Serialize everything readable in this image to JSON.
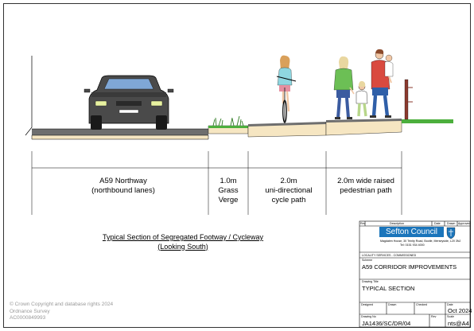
{
  "labels": {
    "lanes": [
      "A59 Northway",
      "(northbound lanes)"
    ],
    "verge": [
      "1.0m",
      "Grass",
      "Verge"
    ],
    "cycle": [
      "2.0m",
      "uni-directional",
      "cycle path"
    ],
    "footpath": [
      "2.0m wide raised",
      "pedestrian path"
    ]
  },
  "caption": [
    "Typical Section of Segregated Footway / Cycleway",
    "(Looking South)"
  ],
  "copyright": [
    "© Crown Copyright and database rights 2024",
    "Ordnance Survey",
    "AC0000849993"
  ],
  "title_block": {
    "rev_headers": [
      "Rev",
      "Description",
      "Date",
      "Drawn",
      "Approved"
    ],
    "council_name": "Sefton Council",
    "council_address": "Magdalen House, 30 Trinity Road, Bootle, Merseyside, L20 3NJ",
    "council_phone": "Tel: 0151 934 4000",
    "department": "LOCALITY SERVICES - COMMISSIONED",
    "scheme_label": "Scheme",
    "scheme": "A59 CORRIDOR IMPROVEMENTS",
    "drawing_title_label": "Drawing Title",
    "drawing_title": "TYPICAL SECTION",
    "designed_label": "Designed",
    "drawn_label": "Drawn",
    "checked_label": "Checked",
    "date_label": "Date",
    "date": "Oct 2024",
    "drawing_no_label": "Drawing No",
    "drawing_no": "JA1436/SC/DR/04",
    "rev_label": "Rev",
    "scale_label": "Scale",
    "scale": "nts@A4"
  },
  "colors": {
    "grass": "#4caf3d",
    "road_surface": "#6e6e6e",
    "subbase": "#f6e6c2",
    "council_blue": "#1b75bb"
  }
}
